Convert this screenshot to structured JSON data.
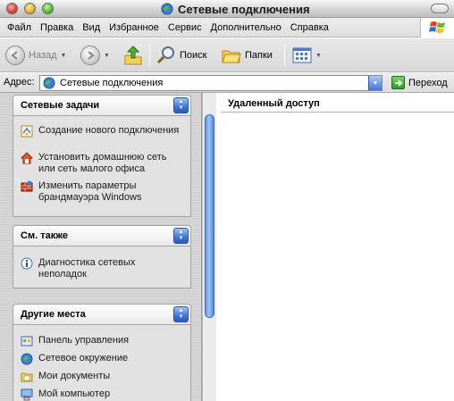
{
  "window": {
    "title": "Сетевые подключения"
  },
  "menu": [
    "Файл",
    "Правка",
    "Вид",
    "Избранное",
    "Сервис",
    "Дополнительно",
    "Справка"
  ],
  "toolbar": {
    "back_label": "Назад",
    "search_label": "Поиск",
    "folders_label": "Папки"
  },
  "address": {
    "label": "Адрес:",
    "value": "Сетевые подключения",
    "go_label": "Переход"
  },
  "panels": [
    {
      "title": "Сетевые задачи",
      "items": [
        {
          "label": "Создание нового подключения",
          "icon": "new-connection-icon"
        },
        {
          "label": "Установить домашнюю сеть или сеть малого офиса",
          "icon": "home-network-icon"
        },
        {
          "label": "Изменить параметры брандмауэра Windows",
          "icon": "firewall-icon"
        }
      ]
    },
    {
      "title": "См. также",
      "items": [
        {
          "label": "Диагностика сетевых неполадок",
          "icon": "info-icon"
        }
      ]
    },
    {
      "title": "Другие места",
      "items": [
        {
          "label": "Панель управления",
          "icon": "control-panel-icon"
        },
        {
          "label": "Сетевое окружение",
          "icon": "network-places-icon"
        },
        {
          "label": "Мои документы",
          "icon": "my-documents-icon"
        },
        {
          "label": "Мой компьютер",
          "icon": "my-computer-icon"
        }
      ]
    }
  ],
  "content": {
    "group_header": "Удаленный доступ"
  },
  "colors": {
    "accent": "#3e76d6",
    "header_line": "#9fb7df"
  }
}
